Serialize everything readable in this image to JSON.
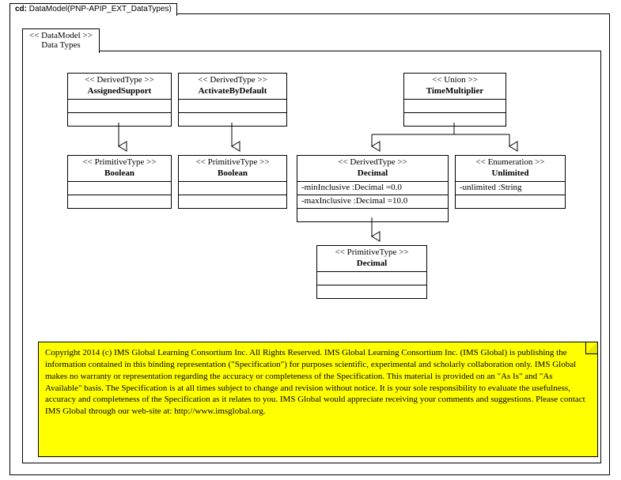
{
  "diagram": {
    "titlePrefix": "cd:",
    "titleName": "DataModel(PNP-APIP_EXT_DataTypes)"
  },
  "package": {
    "stereotype": "<< DataModel >>",
    "name": "Data Types"
  },
  "classes": {
    "assignedSupport": {
      "stereotype": "<<  DerivedType  >>",
      "name": "AssignedSupport"
    },
    "activateByDefault": {
      "stereotype": "<<  DerivedType  >>",
      "name": "ActivateByDefault"
    },
    "timeMultiplier": {
      "stereotype": "<<  Union  >>",
      "name": "TimeMultiplier"
    },
    "booleanA": {
      "stereotype": "<<  PrimitiveType  >>",
      "name": "Boolean"
    },
    "booleanB": {
      "stereotype": "<<  PrimitiveType  >>",
      "name": "Boolean"
    },
    "decimalDerived": {
      "stereotype": "<<  DerivedType  >>",
      "name": "Decimal",
      "attr1": "-minInclusive  :Decimal =0.0",
      "attr2": "-maxInclusive  :Decimal =10.0"
    },
    "unlimited": {
      "stereotype": "<<  Enumeration  >>",
      "name": "Unlimited",
      "attr1": "-unlimited  :String"
    },
    "decimalPrim": {
      "stereotype": "<<  PrimitiveType  >>",
      "name": "Decimal"
    }
  },
  "note": {
    "text": "Copyright 2014 (c) IMS Global Learning Consortium Inc.  All Rights Reserved.  IMS Global Learning Consortium Inc. (IMS Global) is publishing the information contained in this binding representation (\"Specification\") for purposes scientific, experimental and scholarly collaboration only. IMS Global makes no warranty or representation regarding the accuracy or completeness of the Specification.  This material is provided on an \"As Is\" and \"As Available\" basis.  The Specification is at all times subject to change and revision without notice.  It is your sole responsibility to evaluate the usefulness, accuracy and completeness of the Specification as it relates to you.  IMS Global would appreciate receiving your comments and suggestions.  Please contact IMS Global through our web-site at: http://www.imsglobal.org."
  },
  "chart_data": {
    "type": "table",
    "title": "UML class diagram: DataModel(PNP-APIP_EXT_DataTypes) — package Data Types",
    "classes": [
      {
        "name": "AssignedSupport",
        "stereotype": "DerivedType",
        "generalizes_to": "Boolean (PrimitiveType)"
      },
      {
        "name": "ActivateByDefault",
        "stereotype": "DerivedType",
        "generalizes_to": "Boolean (PrimitiveType)"
      },
      {
        "name": "TimeMultiplier",
        "stereotype": "Union",
        "members": [
          "Decimal (DerivedType)",
          "Unlimited (Enumeration)"
        ]
      },
      {
        "name": "Decimal",
        "stereotype": "DerivedType",
        "attributes": [
          "-minInclusive :Decimal =0.0",
          "-maxInclusive :Decimal =10.0"
        ],
        "generalizes_to": "Decimal (PrimitiveType)"
      },
      {
        "name": "Unlimited",
        "stereotype": "Enumeration",
        "attributes": [
          "-unlimited :String"
        ]
      },
      {
        "name": "Boolean",
        "stereotype": "PrimitiveType"
      },
      {
        "name": "Decimal",
        "stereotype": "PrimitiveType"
      }
    ],
    "edges": [
      {
        "from": "AssignedSupport",
        "to": "Boolean (PrimitiveType)",
        "kind": "generalization"
      },
      {
        "from": "ActivateByDefault",
        "to": "Boolean (PrimitiveType)",
        "kind": "generalization"
      },
      {
        "from": "TimeMultiplier",
        "to": "Decimal (DerivedType)",
        "kind": "generalization"
      },
      {
        "from": "TimeMultiplier",
        "to": "Unlimited (Enumeration)",
        "kind": "generalization"
      },
      {
        "from": "Decimal (DerivedType)",
        "to": "Decimal (PrimitiveType)",
        "kind": "generalization"
      }
    ]
  }
}
